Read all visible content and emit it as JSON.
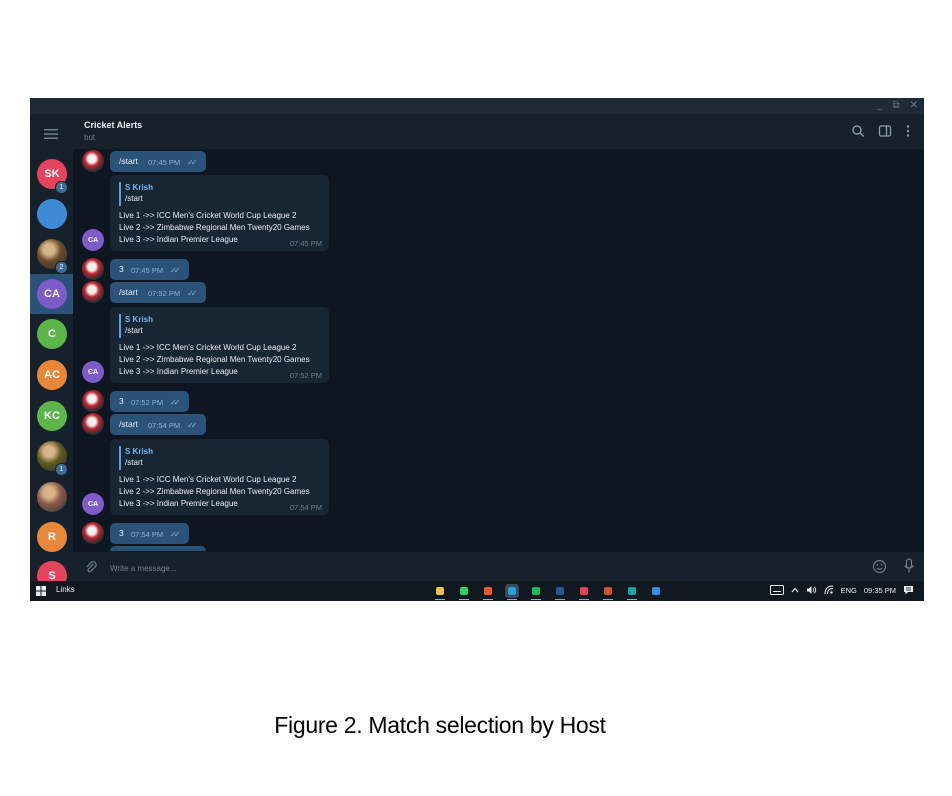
{
  "window": {
    "controls": [
      "_",
      "⧉",
      "✕"
    ]
  },
  "header": {
    "title": "Cricket Alerts",
    "subtitle": "bot",
    "icons": [
      "search-icon",
      "sidebar-icon",
      "more-vert-icon"
    ]
  },
  "rail": {
    "items": [
      {
        "label": "SK",
        "color": "#e6435c",
        "badge": "1"
      },
      {
        "label": "",
        "color": "#3f8ad4",
        "badge": "",
        "icon": "bookmark-icon"
      },
      {
        "label": "",
        "color": "#6b4a2a",
        "badge": "2",
        "icon": "photo-avatar"
      },
      {
        "label": "CA",
        "color": "#7d5bc8",
        "badge": "",
        "active": true
      },
      {
        "label": "C",
        "color": "#5cb548",
        "badge": ""
      },
      {
        "label": "AC",
        "color": "#e8873a",
        "badge": ""
      },
      {
        "label": "KC",
        "color": "#5cb548",
        "badge": ""
      },
      {
        "label": "",
        "color": "#5f5a20",
        "badge": "1",
        "icon": "photo-avatar"
      },
      {
        "label": "",
        "color": "#8a5a4a",
        "badge": "",
        "icon": "photo-avatar"
      },
      {
        "label": "R",
        "color": "#e8873a",
        "badge": ""
      },
      {
        "label": "S",
        "color": "#e6435c",
        "badge": ""
      }
    ]
  },
  "messages": [
    {
      "type": "out",
      "text": "/start",
      "time": "07:45 PM"
    },
    {
      "type": "in",
      "avatar": "CA",
      "quote_name": "S Krish",
      "quote_text": "/start",
      "lines": [
        "Live 1 ->> ICC Men's Cricket World Cup League 2",
        "Live 2 ->> Zimbabwe Regional Men Twenty20 Games",
        "Live 3 ->> Indian Premier League"
      ],
      "time": "07:45 PM"
    },
    {
      "type": "out",
      "text": "3",
      "time": "07:45 PM"
    },
    {
      "type": "out",
      "text": "/start",
      "time": "07:52 PM"
    },
    {
      "type": "in",
      "avatar": "CA",
      "quote_name": "S Krish",
      "quote_text": "/start",
      "lines": [
        "Live 1 ->> ICC Men's Cricket World Cup League 2",
        "Live 2 ->> Zimbabwe Regional Men Twenty20 Games",
        "Live 3 ->> Indian Premier League"
      ],
      "time": "07:52 PM"
    },
    {
      "type": "out",
      "text": "3",
      "time": "07:52 PM"
    },
    {
      "type": "out",
      "text": "/start",
      "time": "07:54 PM"
    },
    {
      "type": "in",
      "avatar": "CA",
      "quote_name": "S Krish",
      "quote_text": "/start",
      "lines": [
        "Live 1 ->> ICC Men's Cricket World Cup League 2",
        "Live 2 ->> Zimbabwe Regional Men Twenty20 Games",
        "Live 3 ->> Indian Premier League"
      ],
      "time": "07:54 PM"
    },
    {
      "type": "out",
      "text": "3",
      "time": "07:54 PM"
    }
  ],
  "composer": {
    "placeholder": "Write a message..."
  },
  "taskbar": {
    "links_label": "Links",
    "apps": [
      {
        "name": "file-explorer-icon",
        "color": "#f2c14e"
      },
      {
        "name": "whatsapp-icon",
        "color": "#25d366"
      },
      {
        "name": "brave-icon",
        "color": "#fb542b"
      },
      {
        "name": "telegram-icon",
        "color": "#2aa1da",
        "active": true
      },
      {
        "name": "spotify-icon",
        "color": "#1db954"
      },
      {
        "name": "word-icon",
        "color": "#2b5797"
      },
      {
        "name": "snipping-tool-icon",
        "color": "#e0435c"
      },
      {
        "name": "powerpoint-icon",
        "color": "#d35230"
      },
      {
        "name": "edge-icon",
        "color": "#1fa3a3"
      },
      {
        "name": "vscode-icon",
        "color": "#2f8fe0"
      }
    ],
    "tray": {
      "language": "ENG",
      "time": "09:35 PM"
    }
  },
  "caption": "Figure 2. Match selection by Host"
}
